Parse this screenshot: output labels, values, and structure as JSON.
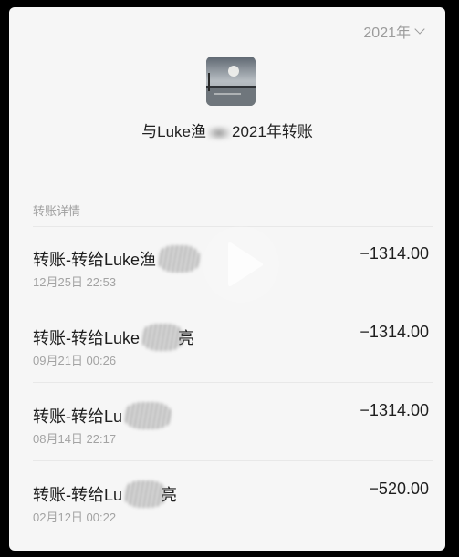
{
  "header": {
    "year_selector": "2021年",
    "title_prefix": "与Luke渔",
    "title_suffix": "2021年转账"
  },
  "section": {
    "label": "转账详情"
  },
  "transactions": [
    {
      "name": "转账-转给Luke渔",
      "name_tail": "",
      "date": "12月25日 22:53",
      "amount": "−1314.00"
    },
    {
      "name": "转账-转给Luke",
      "name_tail": "亮",
      "date": "09月21日 00:26",
      "amount": "−1314.00"
    },
    {
      "name": "转账-转给Lu",
      "name_tail": "",
      "date": "08月14日 22:17",
      "amount": "−1314.00"
    },
    {
      "name": "转账-转给Lu",
      "name_tail": "亮",
      "date": "02月12日 00:22",
      "amount": "−520.00"
    }
  ],
  "icons": {
    "year_chevron": "chevron-down-icon",
    "play": "play-icon",
    "avatar": "landscape-avatar"
  },
  "colors": {
    "background": "#f6f6f6",
    "primary_text": "#1e1e1e",
    "secondary_text": "#a3a3a3"
  }
}
